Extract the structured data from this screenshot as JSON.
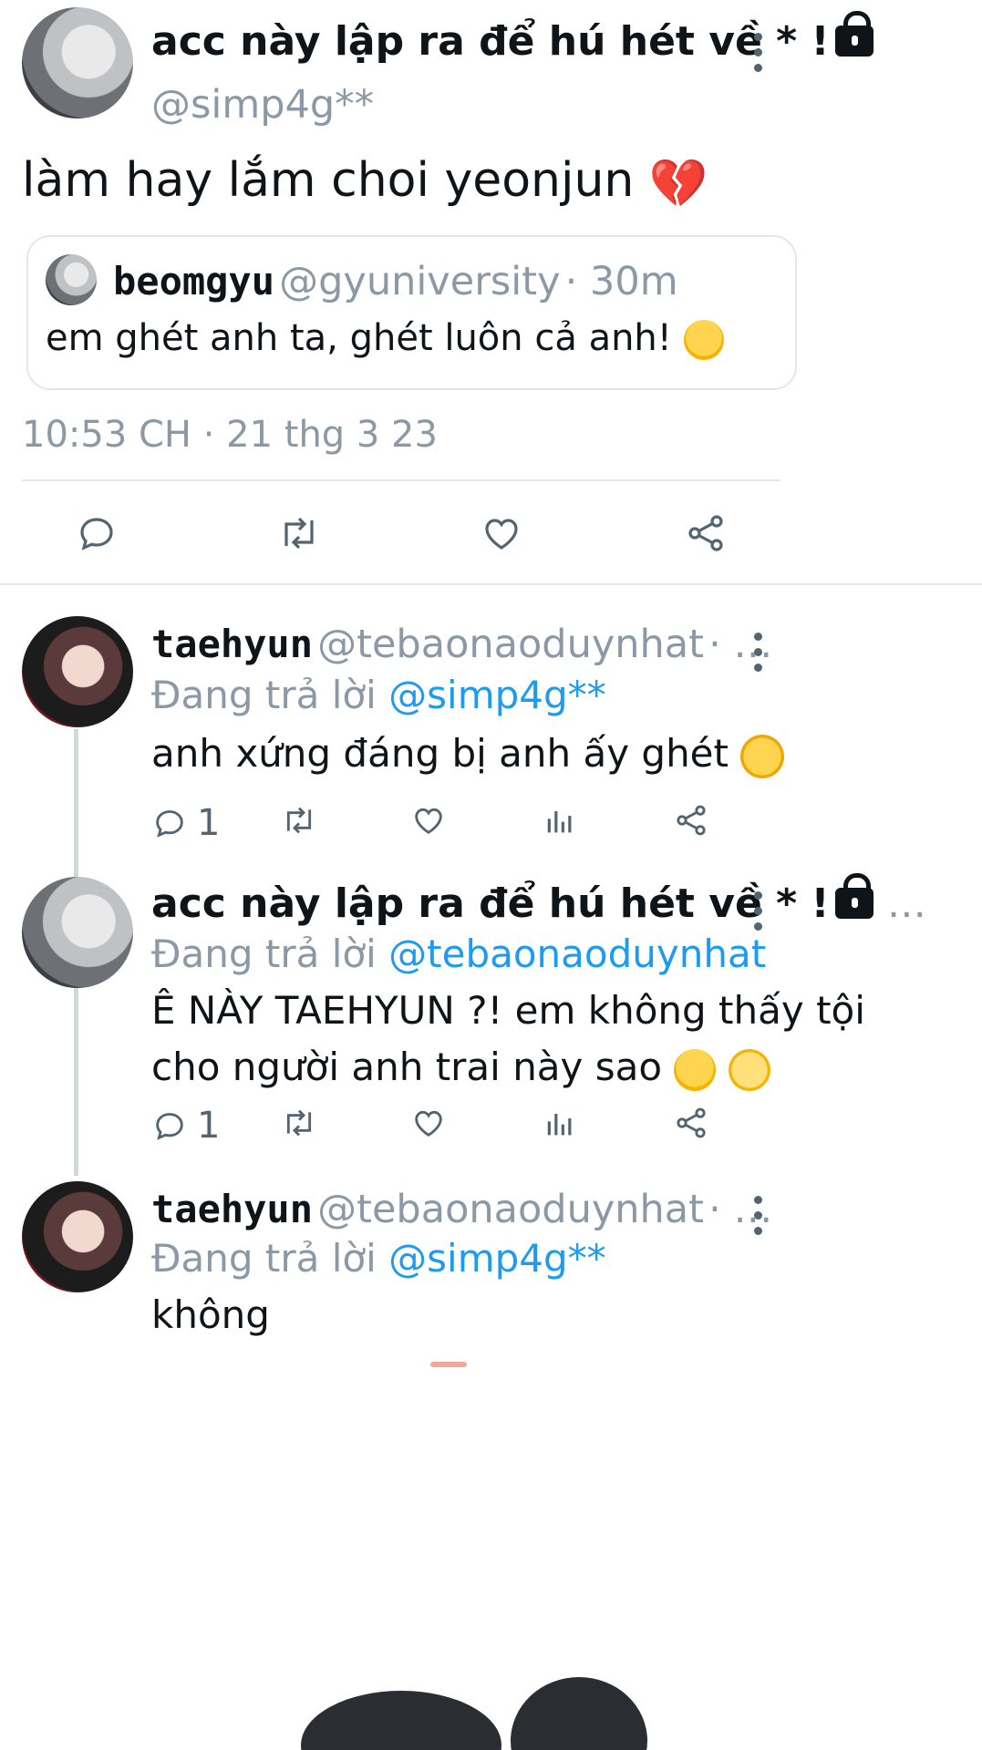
{
  "main_tweet": {
    "display_name": "acc này lập ra để hú hét về * !",
    "handle": "@simp4g**",
    "text": "làm hay lắm choi yeonjun",
    "quote": {
      "display_name": "beomgyu",
      "handle": "@gyuniversity",
      "time": "· 30m",
      "text": "em ghét anh ta, ghét luôn cả anh!"
    },
    "timestamp": "10:53 CH · 21 thg 3 23",
    "icons": [
      "reply-icon",
      "retweet-icon",
      "like-icon",
      "share-icon"
    ]
  },
  "replies": [
    {
      "display_name": "taehyun",
      "handle": "@tebaonaoduynhat",
      "ellipsis": "· …",
      "replying_prefix": "Đang trả lời",
      "replying_to": "@simp4g**",
      "text_lines": [
        "anh xứng đáng bị anh ấy ghét"
      ],
      "reply_count": "1"
    },
    {
      "display_name": "acc này lập ra để hú hét về * !",
      "handle": "",
      "ellipsis": "…",
      "replying_prefix": "Đang trả lời",
      "replying_to": "@tebaonaoduynhat",
      "text_lines": [
        "Ê NÀY TAEHYUN ?! em không thấy tội",
        "cho người anh trai này sao"
      ],
      "reply_count": "1"
    },
    {
      "display_name": "taehyun",
      "handle": "@tebaonaoduynhat",
      "ellipsis": "· …",
      "replying_prefix": "Đang trả lời",
      "replying_to": "@simp4g**",
      "text_lines": [
        "không"
      ]
    }
  ],
  "colors": {
    "link_blue": "#1d9bf0",
    "secondary_gray": "#8b98a5",
    "text_black": "#0f1419"
  }
}
